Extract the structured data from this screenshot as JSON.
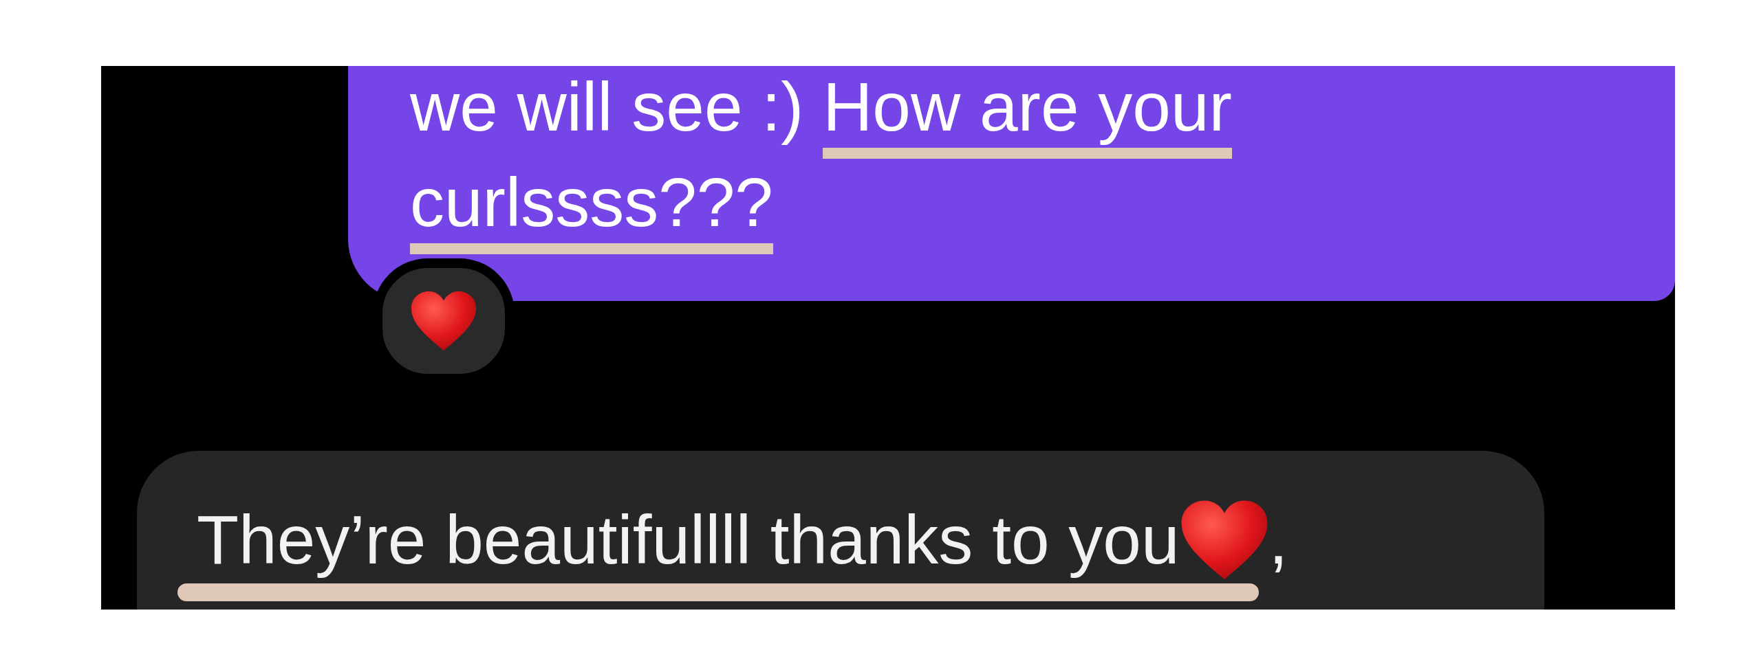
{
  "messages": [
    {
      "kind": "sent",
      "lines": [
        [
          {
            "underlined": false,
            "parts": [
              {
                "kind": "text",
                "text": "we will see :) "
              }
            ]
          },
          {
            "underlined": true,
            "parts": [
              {
                "kind": "text",
                "text": "How are your"
              }
            ]
          }
        ],
        [
          {
            "underlined": true,
            "parts": [
              {
                "kind": "text",
                "text": "curlssss???"
              }
            ]
          }
        ]
      ],
      "reactions": [
        {
          "kind": "heart"
        }
      ]
    },
    {
      "kind": "received",
      "lines": [
        [
          {
            "underlined": true,
            "parts": [
              {
                "kind": "text",
                "text": "They’re beautifullll thanks to you"
              },
              {
                "kind": "heart"
              }
            ]
          },
          {
            "underlined": false,
            "parts": [
              {
                "kind": "text",
                "text": ","
              }
            ]
          }
        ]
      ]
    }
  ]
}
